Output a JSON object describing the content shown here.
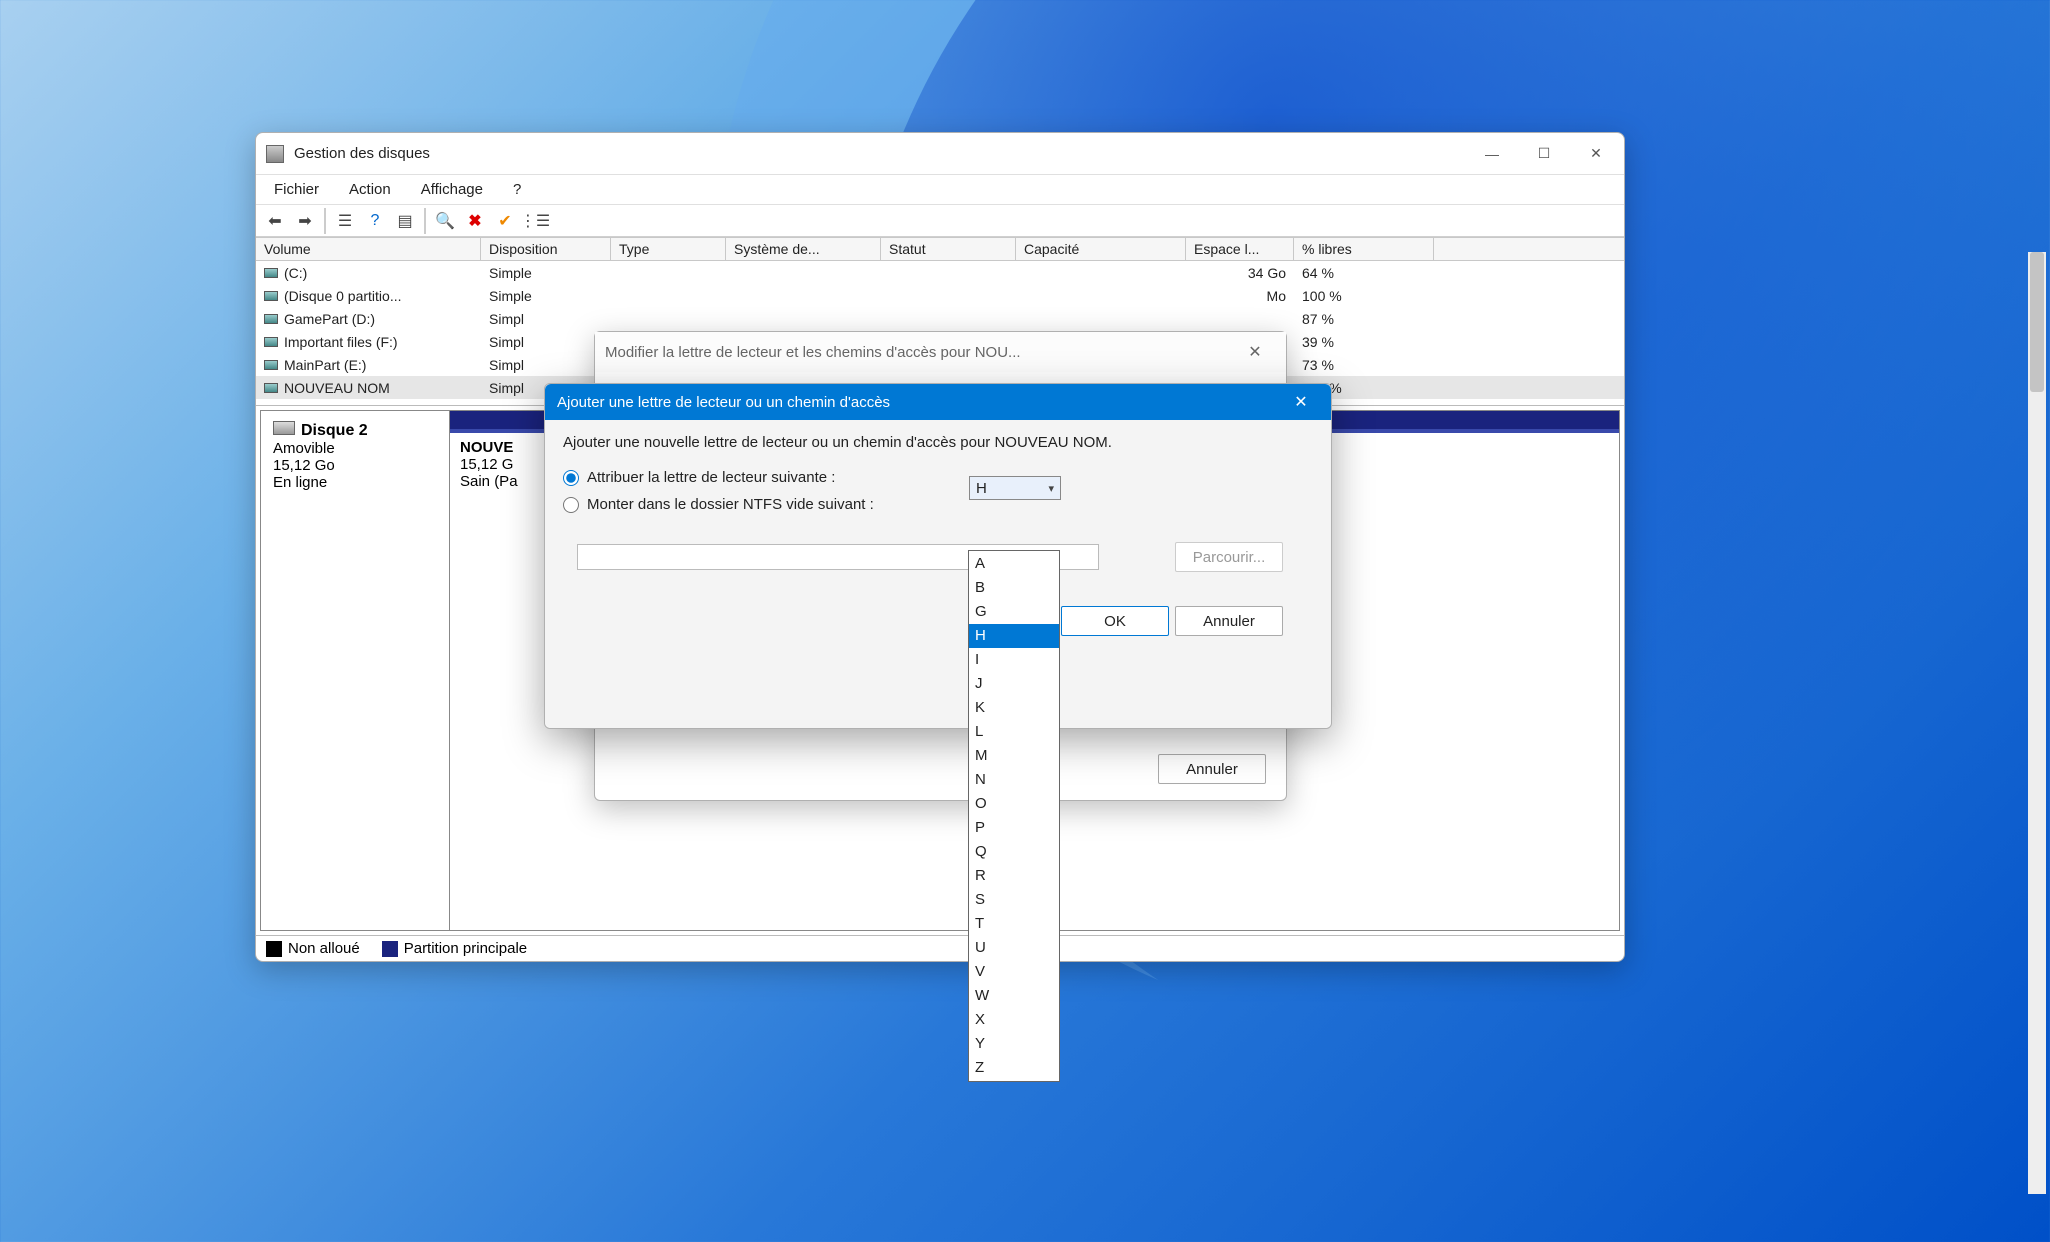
{
  "main": {
    "title": "Gestion des disques",
    "menu": {
      "file": "Fichier",
      "action": "Action",
      "view": "Affichage",
      "help": "?"
    },
    "columns": {
      "volume": "Volume",
      "disposition": "Disposition",
      "type": "Type",
      "system": "Système de...",
      "status": "Statut",
      "capacity": "Capacité",
      "freespace": "Espace l...",
      "pctfree": "% libres"
    },
    "rows": [
      {
        "vol": "(C:)",
        "disp": "Simple",
        "cap_tail": "34 Go",
        "pct": "64 %"
      },
      {
        "vol": "(Disque 0 partitio...",
        "disp": "Simple",
        "cap_tail": "Mo",
        "pct": "100 %"
      },
      {
        "vol": "GamePart (D:)",
        "disp": "Simpl",
        "cap_tail": "",
        "pct": "87 %"
      },
      {
        "vol": "Important files (F:)",
        "disp": "Simpl",
        "cap_tail": "",
        "pct": "39 %"
      },
      {
        "vol": "MainPart (E:)",
        "disp": "Simpl",
        "cap_tail": "",
        "pct": "73 %"
      },
      {
        "vol": "NOUVEAU NOM",
        "disp": "Simpl",
        "cap_tail": "",
        "pct": "100 %"
      }
    ],
    "disk": {
      "name": "Disque 2",
      "removable": "Amovible",
      "size": "15,12 Go",
      "status": "En ligne",
      "partition": {
        "name": "NOUVE",
        "size_line": "15,12 G",
        "health": "Sain (Pa"
      }
    },
    "legend": {
      "unalloc": "Non alloué",
      "primary": "Partition principale"
    }
  },
  "modify": {
    "title": "Modifier la lettre de lecteur et les chemins d'accès pour NOU...",
    "cancel": "Annuler"
  },
  "add": {
    "title": "Ajouter une lettre de lecteur ou un chemin d'accès",
    "subtitle": "Ajouter une nouvelle lettre de lecteur ou un chemin d'accès pour NOUVEAU NOM.",
    "opt_letter": "Attribuer la lettre de lecteur suivante :",
    "opt_mount": "Monter dans le dossier NTFS vide suivant :",
    "selected": "H",
    "browse": "Parcourir...",
    "ok": "OK",
    "cancel": "Annuler",
    "letters": [
      "A",
      "B",
      "G",
      "H",
      "I",
      "J",
      "K",
      "L",
      "M",
      "N",
      "O",
      "P",
      "Q",
      "R",
      "S",
      "T",
      "U",
      "V",
      "W",
      "X",
      "Y",
      "Z"
    ]
  }
}
